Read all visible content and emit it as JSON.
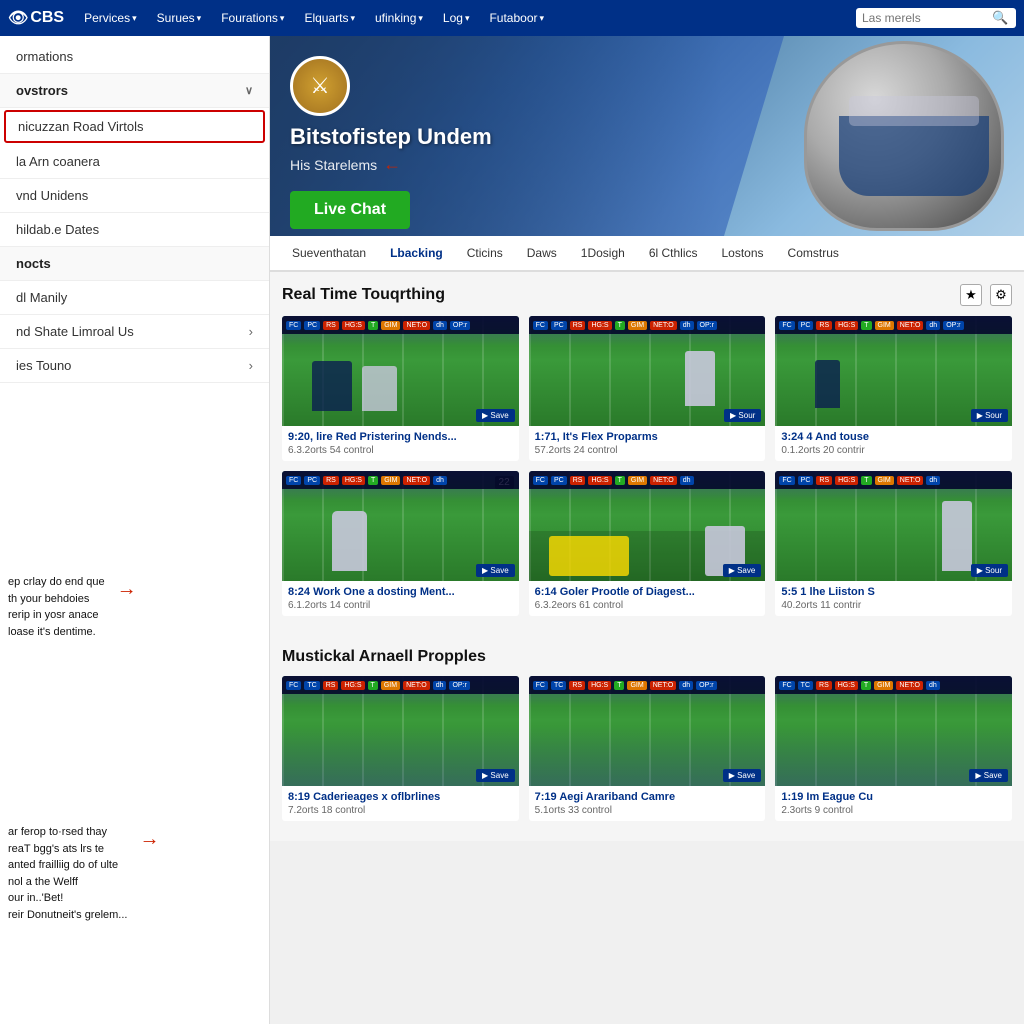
{
  "nav": {
    "logo": "CBS",
    "items": [
      {
        "label": "Pervices",
        "has_dropdown": true
      },
      {
        "label": "Surues",
        "has_dropdown": true
      },
      {
        "label": "Fourations",
        "has_dropdown": true
      },
      {
        "label": "Elquarts",
        "has_dropdown": true
      },
      {
        "label": "ufinking",
        "has_dropdown": true
      },
      {
        "label": "Log",
        "has_dropdown": true
      },
      {
        "label": "Futaboor",
        "has_dropdown": true
      }
    ],
    "search_placeholder": "Las merels"
  },
  "sidebar": {
    "items": [
      {
        "label": "ormations",
        "type": "item"
      },
      {
        "label": "ovstrors",
        "type": "section",
        "has_chevron": true
      },
      {
        "label": "nicuzzan Road Virtols",
        "type": "item",
        "highlighted": true
      },
      {
        "label": "la Arn coanera",
        "type": "item"
      },
      {
        "label": "vnd Unidens",
        "type": "item"
      },
      {
        "label": "hildab.e Dates",
        "type": "item"
      },
      {
        "label": "nocts",
        "type": "section"
      },
      {
        "label": "dl Manily",
        "type": "item"
      },
      {
        "label": "nd Shate Limroal Us",
        "type": "item",
        "has_arrow": true
      },
      {
        "label": "ies Touno",
        "type": "item",
        "has_arrow": true
      }
    ]
  },
  "hero": {
    "logo_icon": "⚔",
    "title": "Bitstofistep Undem",
    "subtitle": "His Starelems",
    "live_chat_label": "Live Chat"
  },
  "sub_nav": {
    "items": [
      {
        "label": "Sueventhatan",
        "active": false
      },
      {
        "label": "Lbacking",
        "active": true
      },
      {
        "label": "Cticins",
        "active": false
      },
      {
        "label": "Daws",
        "active": false
      },
      {
        "label": "1Dosigh",
        "active": false
      },
      {
        "label": "6l Cthlics",
        "active": false
      },
      {
        "label": "Lostons",
        "active": false
      },
      {
        "label": "Comstrus",
        "active": false
      }
    ]
  },
  "sections": [
    {
      "title": "Real Time Touqrthing",
      "videos": [
        {
          "title": "9:20, lire Red Pristering Nends...",
          "meta": "6.3.2orts  54 control"
        },
        {
          "title": "1:71, It's Flex Proparms",
          "meta": "57.2orts  24 control"
        },
        {
          "title": "3:24 4 And touse",
          "meta": "0.1.2orts  20 contrir"
        },
        {
          "title": "8:24  Work One a dosting Ment...",
          "meta": "6.1.2orts  14 contril"
        },
        {
          "title": "6:14  Goler Prootle of Diagest...",
          "meta": "6.3.2eors  61 control"
        },
        {
          "title": "5:5 1  lhe Liiston S",
          "meta": "40.2orts  11 contrir"
        }
      ]
    },
    {
      "title": "Mustickal Arnaell Propples",
      "videos": [
        {
          "title": "8:19  Caderieages x oflbrlines",
          "meta": "7.2orts  18 control"
        },
        {
          "title": "7:19  Aegi Arariband Camre",
          "meta": "5.1orts  33 control"
        },
        {
          "title": "1:19  Im Eague Cu",
          "meta": "2.3orts  9 control"
        }
      ]
    }
  ],
  "annotations": [
    {
      "text": "ep crlay do end que\nth your behdoies\nrerip in yosr anace\nloase it's dentime."
    },
    {
      "text": "ar ferop to·rsed thay\nreaT bgg's ats lrs te\nanted frailliig do of ulte\nnol a the Welff\nour in..'Bet!\nreir Donutneit's grelem..."
    }
  ],
  "toolbar_buttons": [
    "PC",
    "RS",
    "HG:S",
    "T",
    "GIM",
    "NET:O",
    "dh",
    "OP:r"
  ]
}
